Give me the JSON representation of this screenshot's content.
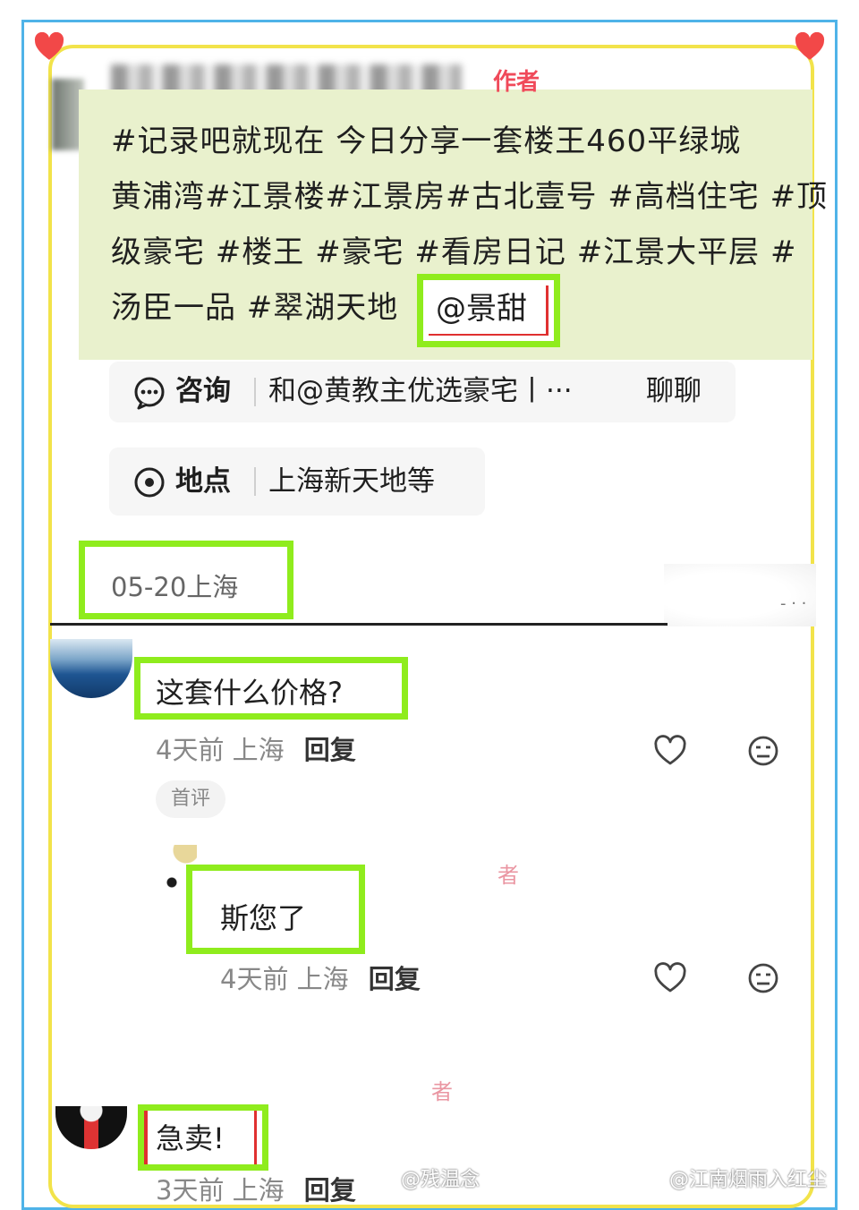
{
  "post": {
    "author_tag": "作者",
    "lines": [
      "#记录吧就现在 今日分享一套楼王460平绿城",
      "黄浦湾#江景楼#江景房#古北壹号 #高档住宅 #顶",
      "级豪宅 #楼王 #豪宅 #看房日记 #江景大平层 #",
      "汤臣一品 #翠湖天地"
    ],
    "mention": "@景甜"
  },
  "consult": {
    "label": "咨询",
    "text": "和@黄教主优选豪宅丨···",
    "action": "聊聊"
  },
  "location": {
    "label": "地点",
    "text": "上海新天地等"
  },
  "date": "05-20上海",
  "comments": [
    {
      "text": "这套什么价格?",
      "time": "4天前",
      "place": "上海",
      "reply": "回复",
      "badge": "首评"
    },
    {
      "text": "斯您了",
      "time": "4天前",
      "place": "上海",
      "reply": "回复",
      "tag": "者"
    },
    {
      "text": "急卖!",
      "time": "3天前",
      "place": "上海",
      "reply": "回复",
      "tag": "者"
    }
  ],
  "watermarks": [
    "@残温念",
    "@江南烟雨入红尘"
  ],
  "colors": {
    "highlight": "#8fec1d",
    "author": "#f04a5a",
    "frame_blue": "#4fb3e8",
    "frame_yellow": "#f2e34a",
    "post_bg": "#e9f1cd"
  },
  "icons": [
    "heart-icon",
    "dislike-face-icon",
    "chat-bubble-icon",
    "location-pin-icon"
  ]
}
